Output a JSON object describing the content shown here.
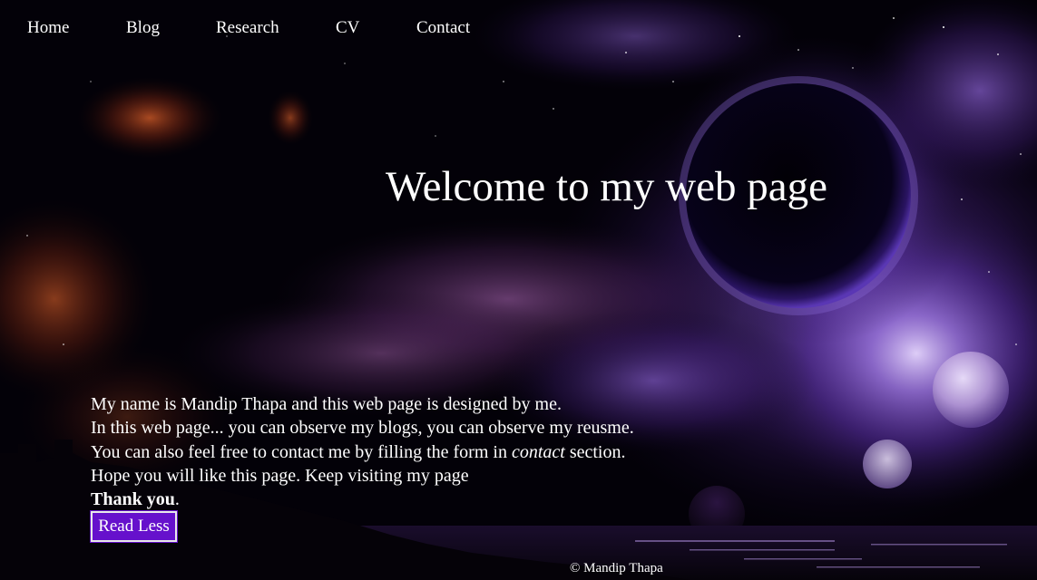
{
  "nav": {
    "items": [
      {
        "label": "Home"
      },
      {
        "label": "Blog"
      },
      {
        "label": "Research"
      },
      {
        "label": "CV"
      },
      {
        "label": "Contact"
      }
    ]
  },
  "hero": {
    "title": "Welcome to my web page"
  },
  "intro": {
    "line1": "My name is Mandip Thapa and this web page is designed by me.",
    "line2": "In this web page... you can observe my blogs, you can observe my reusme.",
    "line3_before": "You can also feel free to contact me by filling the form in ",
    "line3_em": "contact",
    "line3_after": " section.",
    "line4": "Hope you will like this page. Keep visiting my page",
    "thanks": "Thank you",
    "thanks_punct": "."
  },
  "read_button": {
    "label": "Read Less"
  },
  "footer": {
    "copyright": "© Mandip Thapa"
  },
  "colors": {
    "button_bg": "#6611cc",
    "text": "#ffffff",
    "nebula_purple": "#7b4fd0",
    "nebula_orange": "#c0461c"
  }
}
